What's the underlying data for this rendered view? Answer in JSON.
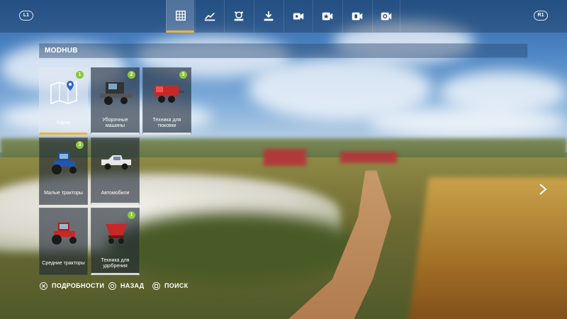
{
  "topbar": {
    "left_bumper": "L1",
    "right_bumper": "R1",
    "tabs": [
      {
        "icon": "grid-icon",
        "active": true
      },
      {
        "icon": "price-chart-icon"
      },
      {
        "icon": "animals-icon"
      },
      {
        "icon": "download-icon"
      },
      {
        "icon": "video-star-icon"
      },
      {
        "icon": "star-icon"
      },
      {
        "icon": "hand-icon"
      },
      {
        "icon": "settings-icon"
      }
    ]
  },
  "header": {
    "title": "MODHUB"
  },
  "tiles": [
    {
      "label": "Карта",
      "badge": "1",
      "image": "map-icon"
    },
    {
      "label": "Уборочные машины",
      "badge": "2",
      "image": "harvester-icon"
    },
    {
      "label": "Техника для тюковки",
      "badge": "3",
      "image": "baler-icon"
    },
    {
      "label": "Малые тракторы",
      "badge": "3",
      "image": "small-tractor-icon"
    },
    {
      "label": "Автомобили",
      "badge": "",
      "image": "pickup-truck-icon"
    },
    {
      "label": "Средние тракторы",
      "badge": "",
      "image": "medium-tractor-icon"
    },
    {
      "label": "Техника для удобрения",
      "badge": "1",
      "image": "fertilizer-spreader-icon"
    }
  ],
  "hints": [
    {
      "button": "cross-button-icon",
      "label": "ПОДРОБНОСТИ"
    },
    {
      "button": "circle-button-icon",
      "label": "НАЗАД"
    },
    {
      "button": "square-button-icon",
      "label": "ПОИСК"
    }
  ],
  "colors": {
    "accent": "#f2b233",
    "badge": "#8cc63f"
  }
}
